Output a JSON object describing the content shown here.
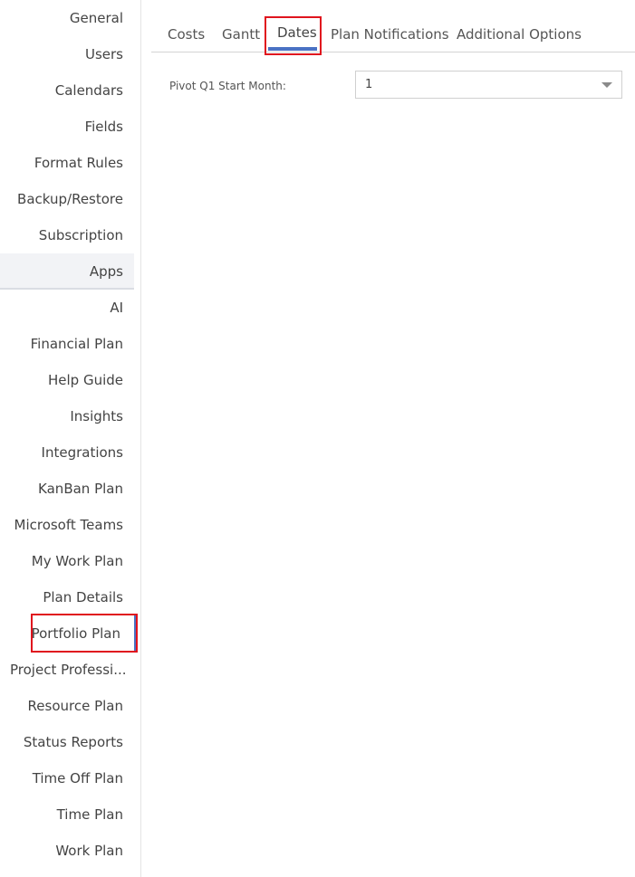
{
  "sidebar": {
    "items": [
      {
        "label": "General"
      },
      {
        "label": "Users"
      },
      {
        "label": "Calendars"
      },
      {
        "label": "Fields"
      },
      {
        "label": "Format Rules"
      },
      {
        "label": "Backup/Restore"
      },
      {
        "label": "Subscription"
      },
      {
        "label": "Apps"
      },
      {
        "label": "AI"
      },
      {
        "label": "Financial Plan"
      },
      {
        "label": "Help Guide"
      },
      {
        "label": "Insights"
      },
      {
        "label": "Integrations"
      },
      {
        "label": "KanBan Plan"
      },
      {
        "label": "Microsoft Teams"
      },
      {
        "label": "My Work Plan"
      },
      {
        "label": "Plan Details"
      },
      {
        "label": "Portfolio Plan"
      },
      {
        "label": "Project Professi..."
      },
      {
        "label": "Resource Plan"
      },
      {
        "label": "Status Reports"
      },
      {
        "label": "Time Off Plan"
      },
      {
        "label": "Time Plan"
      },
      {
        "label": "Work Plan"
      }
    ],
    "selected": "Portfolio Plan"
  },
  "tabs": {
    "items": [
      {
        "label": "Costs"
      },
      {
        "label": "Gantt"
      },
      {
        "label": "Dates"
      },
      {
        "label": "Plan Notifications"
      },
      {
        "label": "Additional Options"
      }
    ],
    "active": "Dates"
  },
  "dates": {
    "pivot_label": "Pivot Q1 Start Month:",
    "pivot_value": "1"
  },
  "colors": {
    "accent": "#4a72c4",
    "highlight": "#e0141e"
  }
}
